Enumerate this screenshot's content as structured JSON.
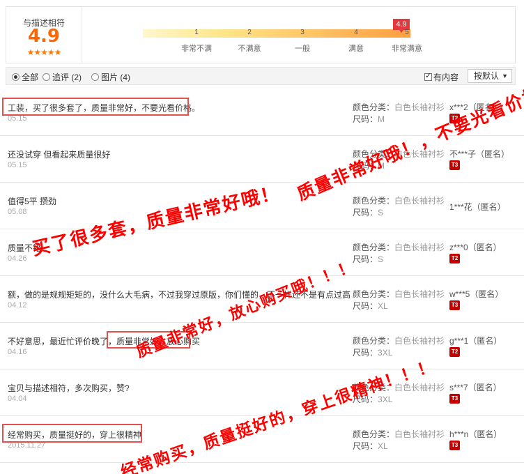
{
  "rating": {
    "title": "与描述相符",
    "score": "4.9",
    "stars": "★★★★★",
    "badge": "4.9",
    "ticks": [
      "1",
      "2",
      "3",
      "4",
      "5"
    ],
    "labels": [
      "非常不满",
      "不满意",
      "一般",
      "满意",
      "非常满意"
    ]
  },
  "filter": {
    "all": "全部",
    "followup": "追评 (2)",
    "images": "图片 (4)",
    "has_content": "有内容",
    "sort": "按默认",
    "sort_arrow": "▼"
  },
  "sku_labels": {
    "color": "颜色分类：",
    "size": "尺码："
  },
  "reviews": [
    {
      "content": "工装，买了很多套了，质量非常好，不要光看价格。",
      "date": "05.15",
      "color": "白色长袖衬衫",
      "size": "M",
      "user": "x***2（匿名）",
      "level": "T2"
    },
    {
      "content": "还没试穿 但看起来质量很好",
      "date": "05.15",
      "color": "白色长袖衬衫",
      "size": "M",
      "user": "不***子（匿名）",
      "level": "T3"
    },
    {
      "content": "值得5平 攒劲",
      "date": "05.08",
      "color": "白色长袖衬衫",
      "size": "S",
      "user": "1***花（匿名）",
      "level": ""
    },
    {
      "content": "质量不错",
      "date": "04.26",
      "color": "白色长袖衬衫",
      "size": "S",
      "user": "z***0（匿名）",
      "level": "T2"
    },
    {
      "content": "额，做的是规规矩矩的，没什么大毛病，不过我穿过原版，你们懂的，不一样还不是有点过高",
      "date": "04.12",
      "color": "白色长袖衬衫",
      "size": "XL",
      "user": "w***5（匿名）",
      "level": "T3"
    },
    {
      "content": "不好意思，最近忙评价晚了，质量非常好，放心购买",
      "date": "04.16",
      "color": "白色长袖衬衫",
      "size": "3XL",
      "user": "g***1（匿名）",
      "level": "T2"
    },
    {
      "content": "宝贝与描述相符，多次购买，赞?",
      "date": "04.04",
      "color": "白色长袖衬衫",
      "size": "3XL",
      "user": "s***7（匿名）",
      "level": "T3"
    },
    {
      "content": "经常购买，质量挺好的，穿上很精神",
      "date": "2015.11.27",
      "color": "白色长袖衬衫",
      "size": "XL",
      "user": "h***n（匿名）",
      "level": "T3"
    }
  ],
  "overlay": [
    "质量非常好哦！，不要光看价格哦！！！",
    "买了很多套，质量非常好哦！",
    "质量非常好，放心购买哦！！！",
    "经常购买，质量挺好的，穿上很精神！！！"
  ],
  "colors": {
    "accent": "#ff6600",
    "overlay_red": "#ff0000",
    "badge_red": "#e4393c",
    "highlight_border": "#e35050"
  }
}
